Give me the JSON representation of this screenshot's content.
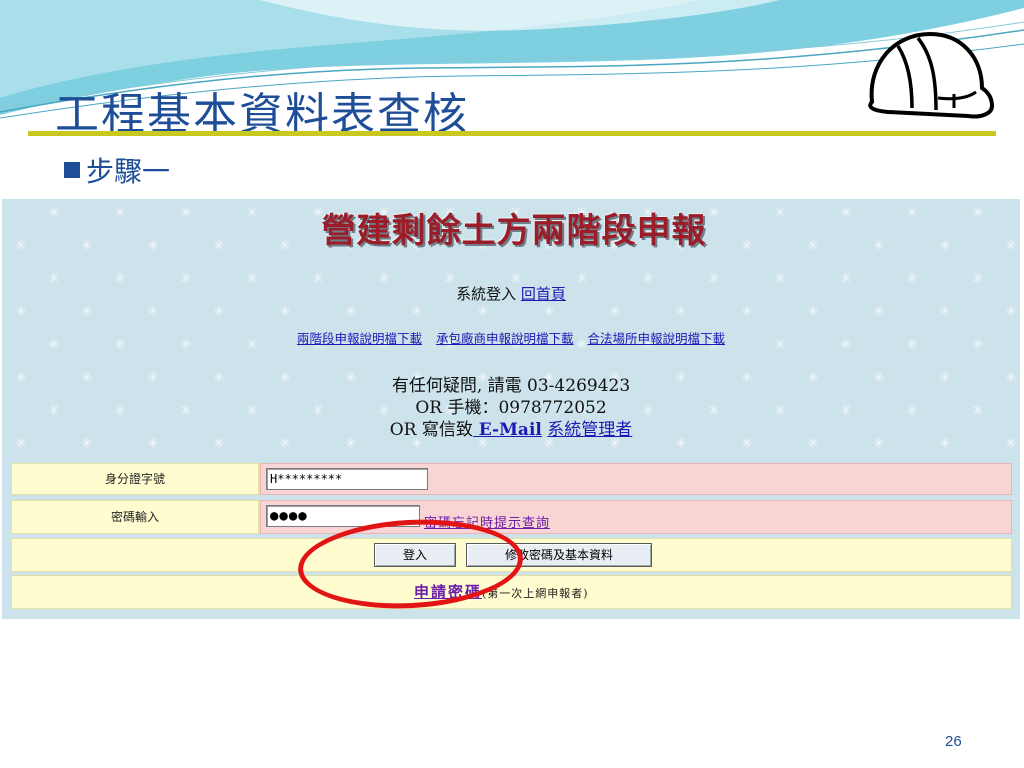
{
  "slide": {
    "title": "工程基本資料表查核",
    "step": "步驟一",
    "page_number": "26"
  },
  "screenshot": {
    "banner": "營建剩餘土方兩階段申報",
    "login_text": "系統登入",
    "home_link": "回首頁",
    "links": [
      "兩階段申報說明檔下載",
      "承包廠商申報說明檔下載",
      "合法場所申報說明檔下載"
    ],
    "contact": {
      "line1": "有任何疑問, 請電 03-4269423",
      "line2": "OR 手機：0978772052",
      "line3_prefix": "OR 寫信致",
      "email_link": " E-Mail",
      "admin_link": "系統管理者"
    },
    "form": {
      "id_label": "身分證字號",
      "id_value": "H*********",
      "password_label": "密碼輸入",
      "password_value": "●●●●",
      "forgot_link": "密碼忘記時提示查詢",
      "login_button": "登入",
      "modify_button": "修改密碼及基本資料",
      "apply_link": "申請密碼",
      "apply_note": "(第一次上網申報者)"
    }
  },
  "colors": {
    "title": "#1f4e99",
    "accent_line": "#c8c81e",
    "highlight_circle": "#e21414",
    "screenshot_bg": "#cde3ec"
  }
}
